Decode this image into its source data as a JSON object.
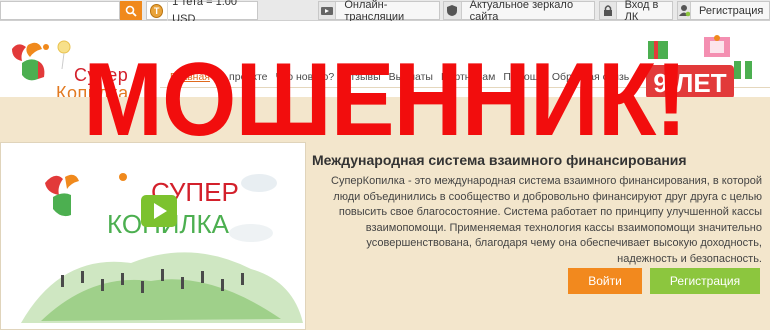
{
  "topbar": {
    "search_placeholder": "",
    "search_icon": "search-icon",
    "rate_coin": "T",
    "rate_text": "1 тета = 1.00 USD",
    "links": [
      {
        "label": "Онлайн-трансляции",
        "icon": "broadcast-icon"
      },
      {
        "label": "Актуальное зеркало сайта",
        "icon": "shield-icon"
      },
      {
        "label": "Вход в ЛК",
        "icon": "lock-icon"
      },
      {
        "label": "Регистрация",
        "icon": "user-icon"
      }
    ]
  },
  "header": {
    "logo_line1": "Супер",
    "logo_line2": "Копилка",
    "anniversary": "9 ЛЕТ",
    "nav": [
      {
        "label": "Главная",
        "active": true
      },
      {
        "label": "О проекте",
        "active": false
      },
      {
        "label": "Что нового?",
        "active": false
      },
      {
        "label": "Отзывы",
        "active": false
      },
      {
        "label": "Выплаты",
        "active": false
      },
      {
        "label": "Партнерам",
        "active": false
      },
      {
        "label": "Помощь",
        "active": false
      },
      {
        "label": "Обратная связь",
        "active": false
      }
    ]
  },
  "watermark": "МОШЕННИК!",
  "video": {
    "logo_line1": "СУПЕР",
    "logo_line2": "КОПИЛКА"
  },
  "main": {
    "title": "Международная система взаимного финансирования",
    "description": "СуперКопилка - это международная система взаимного финансирования, в которой люди объединились в сообщество и добровольно финансируют друг друга с целью повысить свое благосостояние. Система работает по принципу улучшенной кассы взаимопомощи. Применяемая технология кассы взаимопомощи значительно усовершенствована, благодаря чему она обеспечивает высокую доходность, надежность и безопасность.",
    "login_label": "Войти",
    "register_label": "Регистрация"
  },
  "colors": {
    "accent_orange": "#f2891e",
    "accent_green": "#8cc63e",
    "watermark_red": "#f20d0d",
    "background": "#f3e6cc"
  }
}
